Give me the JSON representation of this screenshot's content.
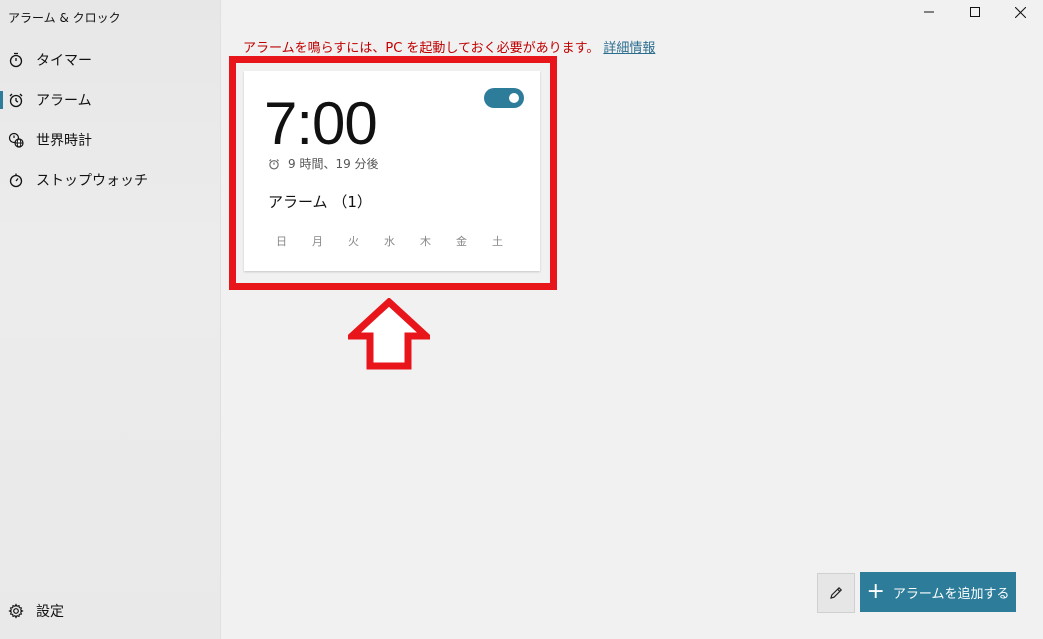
{
  "window": {
    "title": "アラーム & クロック"
  },
  "sidebar": {
    "items": [
      {
        "label": "タイマー",
        "icon": "stopwatch-icon"
      },
      {
        "label": "アラーム",
        "icon": "alarm-clock-icon",
        "active": true
      },
      {
        "label": "世界時計",
        "icon": "globe-clock-icon"
      },
      {
        "label": "ストップウォッチ",
        "icon": "stopwatch-icon"
      }
    ],
    "settings_label": "設定"
  },
  "main": {
    "warning_text": "アラームを鳴らすには、PC を起動しておく必要があります。",
    "warning_link": "詳細情報"
  },
  "alarm_card": {
    "time": "7:00",
    "enabled": true,
    "remaining": "9 時間、19 分後",
    "name": "アラーム （1）",
    "days": [
      "日",
      "月",
      "火",
      "水",
      "木",
      "金",
      "土"
    ]
  },
  "toolbar": {
    "add_label": "アラームを追加する"
  },
  "colors": {
    "accent": "#2d7d9a",
    "warning": "#c00000",
    "highlight": "#e8151b"
  }
}
